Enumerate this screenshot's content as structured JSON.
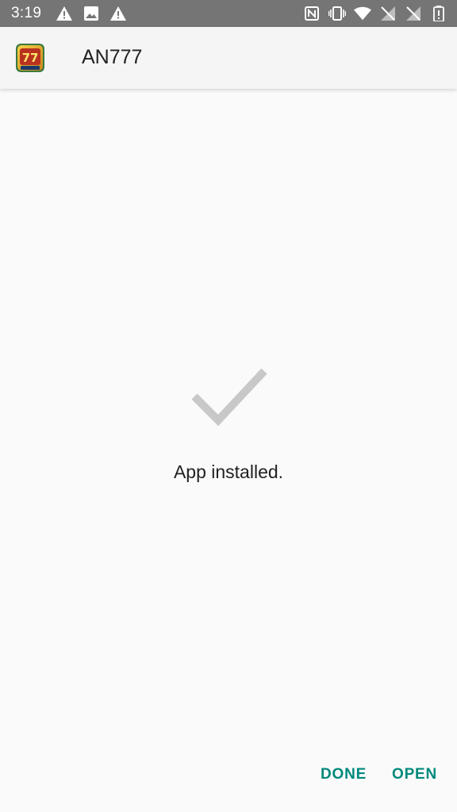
{
  "status_bar": {
    "time": "3:19",
    "left_icons": [
      "alert-icon",
      "image-icon",
      "alert-icon"
    ],
    "right_icons": [
      "nfc-icon",
      "vibrate-icon",
      "wifi-icon",
      "signal-no-sim-icon",
      "signal-no-sim-icon",
      "battery-icon"
    ],
    "background": "#757575"
  },
  "app_bar": {
    "title": "AN777",
    "icon": "an777-app-icon"
  },
  "main": {
    "icon": "check-icon",
    "message": "App installed."
  },
  "actions": {
    "done_label": "DONE",
    "open_label": "OPEN",
    "accent": "#00897b"
  }
}
